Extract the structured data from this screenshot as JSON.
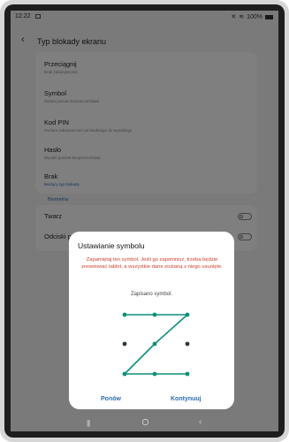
{
  "status_bar": {
    "time": "12:22",
    "icons": [
      "mute-icon",
      "wifi-icon",
      "battery-icon"
    ],
    "battery": "100%"
  },
  "header": {
    "title": "Typ blokady ekranu"
  },
  "lock_options": [
    {
      "label": "Przeciągnij",
      "sub": "Brak zabezpieczeń",
      "current": false
    },
    {
      "label": "Symbol",
      "sub": "Średni poziom bezpieczeństwa",
      "current": false
    },
    {
      "label": "Kod PIN",
      "sub": "Poziom zabezpieczeń od średniego do wysokiego",
      "current": false
    },
    {
      "label": "Hasło",
      "sub": "Wysoki poziom bezpieczeństwa",
      "current": false
    },
    {
      "label": "Brak",
      "sub": "Bieżący typ blokady",
      "current": true
    }
  ],
  "biometrics": {
    "section_label": "Biometria",
    "items": [
      {
        "label": "Twarz"
      },
      {
        "label": "Odciski palców"
      }
    ]
  },
  "dialog": {
    "title": "Ustawianie symbolu",
    "warning": "Zapamiętaj ten symbol. Jeśli go zapomnisz, trzeba będzie zresetować tablet, a wszystkie dane zostaną z niego usunięte.",
    "status": "Zapisano symbol.",
    "pattern": [
      1,
      2,
      3,
      5,
      7,
      8,
      9
    ],
    "retry_label": "Ponów",
    "continue_label": "Kontynuuj"
  },
  "colors": {
    "accent": "#2f6db5",
    "warning": "#d23b2a",
    "pattern": "#0f8f7a"
  }
}
